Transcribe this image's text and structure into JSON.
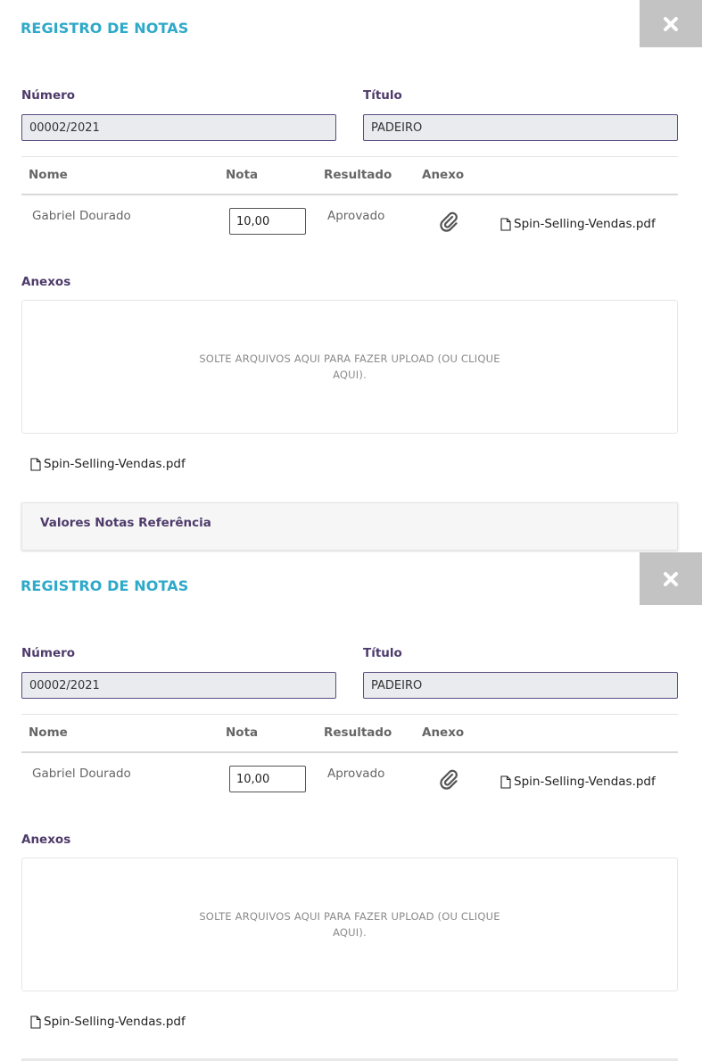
{
  "panels": [
    {
      "title": "REGISTRO DE NOTAS",
      "close_glyph": "✖",
      "numero": {
        "label": "Número",
        "value": "00002/2021"
      },
      "titulo": {
        "label": "Título",
        "value": "PADEIRO"
      },
      "table": {
        "headers": {
          "nome": "Nome",
          "nota": "Nota",
          "resultado": "Resultado",
          "anexo": "Anexo"
        },
        "rows": [
          {
            "nome": "Gabriel Dourado",
            "nota": "10,00",
            "resultado": "Aprovado",
            "anexo_icon": "paperclip-icon",
            "file": "Spin-Selling-Vendas.pdf"
          }
        ]
      },
      "anexos_label": "Anexos",
      "dropzone_text": "SOLTE ARQUIVOS AQUI PARA FAZER UPLOAD (OU CLIQUE AQUI).",
      "attached_file": "Spin-Selling-Vendas.pdf",
      "reference_title": "Valores Notas Referência"
    },
    {
      "title": "REGISTRO DE NOTAS",
      "close_glyph": "✖",
      "numero": {
        "label": "Número",
        "value": "00002/2021"
      },
      "titulo": {
        "label": "Título",
        "value": "PADEIRO"
      },
      "table": {
        "headers": {
          "nome": "Nome",
          "nota": "Nota",
          "resultado": "Resultado",
          "anexo": "Anexo"
        },
        "rows": [
          {
            "nome": "Gabriel Dourado",
            "nota": "10,00",
            "resultado": "Aprovado",
            "anexo_icon": "paperclip-icon",
            "file": "Spin-Selling-Vendas.pdf"
          }
        ]
      },
      "anexos_label": "Anexos",
      "dropzone_text": "SOLTE ARQUIVOS AQUI PARA FAZER UPLOAD (OU CLIQUE AQUI).",
      "attached_file": "Spin-Selling-Vendas.pdf"
    }
  ],
  "colors": {
    "title": "#2fa9c9",
    "label": "#4e3b6b",
    "input_border": "#5a4c82",
    "input_bg": "#e9ebee",
    "close_bg": "#c3c3c3"
  }
}
